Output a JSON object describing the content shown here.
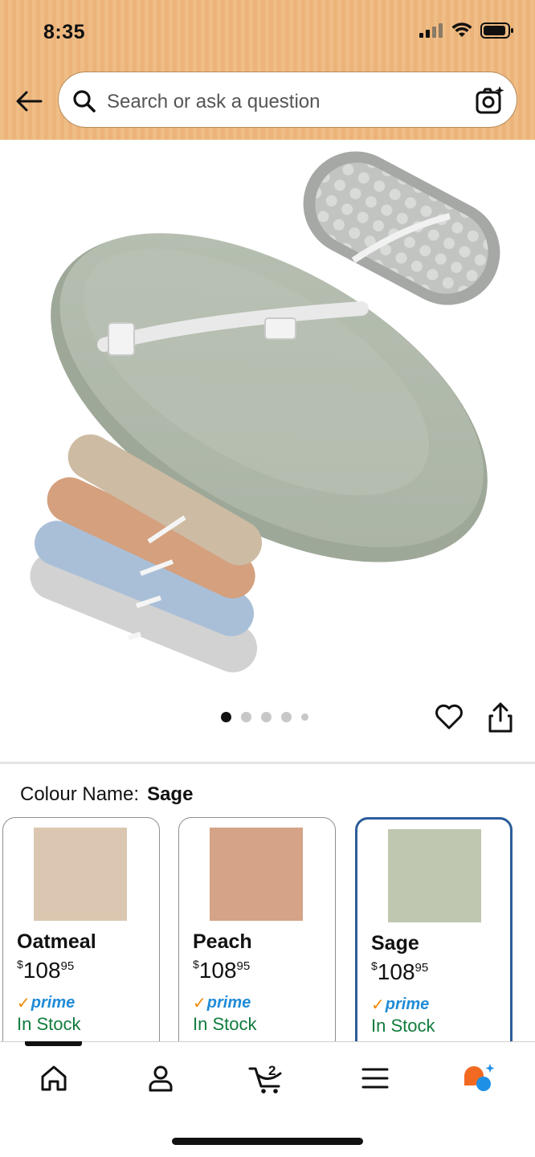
{
  "status_bar": {
    "time": "8:35"
  },
  "search": {
    "placeholder": "Search or ask a question"
  },
  "image_carousel": {
    "dot_count": 5,
    "active_index": 0
  },
  "colour": {
    "label": "Colour Name:",
    "selected": "Sage"
  },
  "variants": [
    {
      "name": "Oatmeal",
      "currency": "$",
      "price_whole": "108",
      "price_cents": "95",
      "prime": "prime",
      "stock": "In Stock",
      "swatch_color": "#dbc7b1"
    },
    {
      "name": "Peach",
      "currency": "$",
      "price_whole": "108",
      "price_cents": "95",
      "prime": "prime",
      "stock": "In Stock",
      "swatch_color": "#d5a387"
    },
    {
      "name": "Sage",
      "currency": "$",
      "price_whole": "108",
      "price_cents": "95",
      "prime": "prime",
      "stock": "In Stock",
      "swatch_color": "#bfc7b1"
    }
  ],
  "nav": {
    "cart_count": "2",
    "items": [
      "home-icon",
      "account-icon",
      "cart-icon",
      "menu-icon",
      "rufus-ai-icon"
    ]
  },
  "colors": {
    "header": "#efbd86",
    "selected_border": "#2b5d9a",
    "in_stock": "#117c3c",
    "prime_blue": "#1f8bd6",
    "prime_check": "#f08804"
  }
}
